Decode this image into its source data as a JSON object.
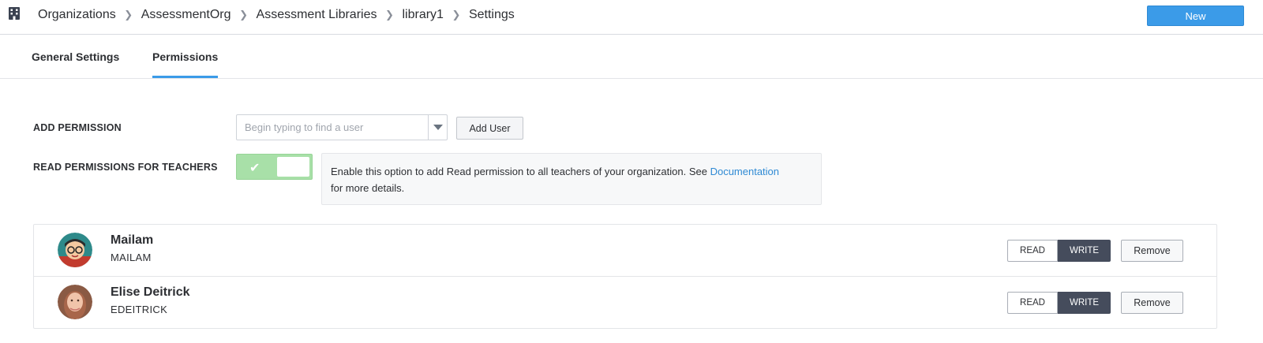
{
  "breadcrumb": [
    "Organizations",
    "AssessmentOrg",
    "Assessment Libraries",
    "library1",
    "Settings"
  ],
  "header": {
    "new_label": "New"
  },
  "tabs": [
    {
      "label": "General Settings",
      "active": false
    },
    {
      "label": "Permissions",
      "active": true
    }
  ],
  "add_permission": {
    "label": "ADD PERMISSION",
    "placeholder": "Begin typing to find a user",
    "button_label": "Add User"
  },
  "read_permissions": {
    "label": "READ PERMISSIONS FOR TEACHERS",
    "enabled": true,
    "info_text": "Enable this option to add Read permission to all teachers of your organization. See ",
    "info_link": "Documentation",
    "info_suffix": "for more details."
  },
  "users": [
    {
      "name": "Mailam",
      "login": "MAILAM",
      "read_label": "READ",
      "write_label": "WRITE",
      "active": "WRITE",
      "remove_label": "Remove"
    },
    {
      "name": "Elise Deitrick",
      "login": "EDEITRICK",
      "read_label": "READ",
      "write_label": "WRITE",
      "active": "WRITE",
      "remove_label": "Remove"
    }
  ],
  "colors": {
    "accent": "#3b9be8",
    "toggle_on": "#a8e0a8",
    "write_active": "#454c5c",
    "link": "#2f8ad4"
  }
}
